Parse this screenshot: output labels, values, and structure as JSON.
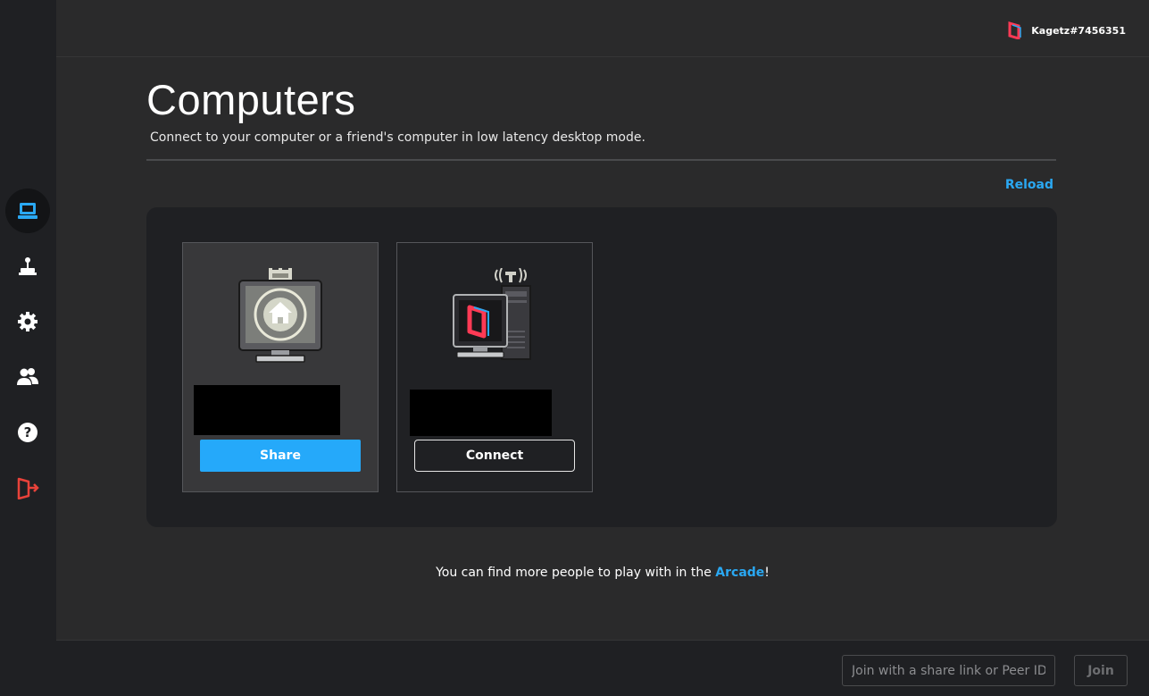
{
  "user": {
    "name": "Kagetz#7456351"
  },
  "sidebar": {
    "items": [
      {
        "icon": "computer-icon",
        "active": true
      },
      {
        "icon": "joystick-icon"
      },
      {
        "icon": "gear-icon"
      },
      {
        "icon": "friends-icon"
      },
      {
        "icon": "help-icon"
      },
      {
        "icon": "logout-icon"
      }
    ]
  },
  "page": {
    "title": "Computers",
    "subtitle": "Connect to your computer or a friend's computer in low latency desktop mode.",
    "reload_label": "Reload"
  },
  "cards": [
    {
      "icon": "home-computer-icon",
      "button_label": "Share"
    },
    {
      "icon": "peer-computer-icon",
      "button_label": "Connect"
    }
  ],
  "footer": {
    "note_prefix": "You can find more people to play with in the ",
    "arcade_link": "Arcade",
    "note_suffix": "!"
  },
  "join": {
    "placeholder": "Join with a share link or Peer ID.",
    "button_label": "Join"
  },
  "colors": {
    "accent": "#25a9fa",
    "brand_red": "#ff3a55",
    "logout_red": "#e8423a"
  }
}
